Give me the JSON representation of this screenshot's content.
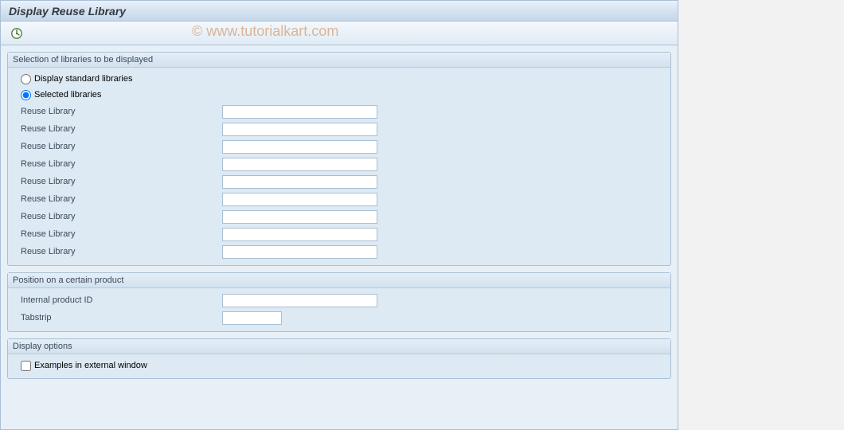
{
  "window_title": "Display Reuse Library",
  "watermark": "© www.tutorialkart.com",
  "group1": {
    "title": "Selection of libraries to be displayed",
    "radio1_label": "Display standard libraries",
    "radio2_label": "Selected libraries",
    "row_label": "Reuse Library",
    "values": [
      "",
      "",
      "",
      "",
      "",
      "",
      "",
      "",
      ""
    ]
  },
  "group2": {
    "title": "Position on a certain product",
    "internal_id_label": "Internal product ID",
    "internal_id_value": "",
    "tabstrip_label": "Tabstrip",
    "tabstrip_value": ""
  },
  "group3": {
    "title": "Display options",
    "checkbox_label": "Examples in external window",
    "checkbox_checked": false
  }
}
